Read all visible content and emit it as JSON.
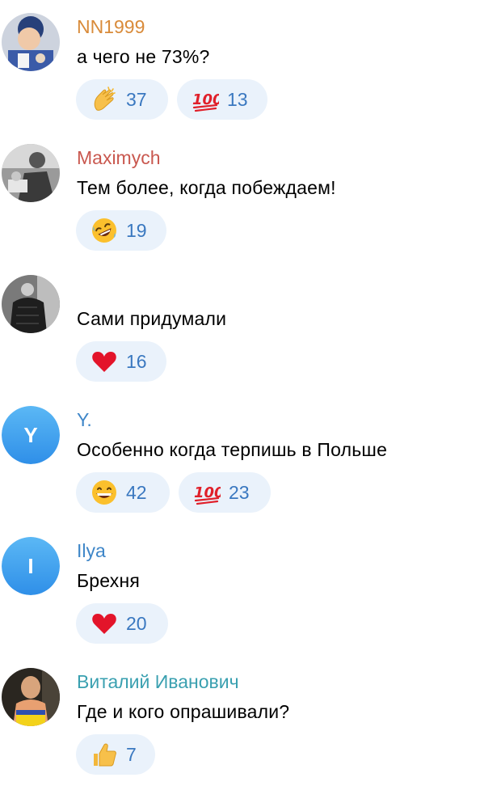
{
  "comments": [
    {
      "author": "NN1999",
      "author_color": "#d98b3a",
      "text": "а чего не 73%?",
      "avatar": "photo",
      "reactions": [
        {
          "emoji": "clapping-hands-icon",
          "count": "37"
        },
        {
          "emoji": "hundred-points-icon",
          "count": "13"
        }
      ]
    },
    {
      "author": "Maximych",
      "author_color": "#c9584f",
      "text": "Тем более, когда побеждаем!",
      "avatar": "photo",
      "reactions": [
        {
          "emoji": "rolling-laughing-face-icon",
          "count": "19"
        }
      ]
    },
    {
      "author": "",
      "text": "Сами придумали",
      "avatar": "photo",
      "reactions": [
        {
          "emoji": "red-heart-icon",
          "count": "16"
        }
      ]
    },
    {
      "author": "Y.",
      "author_color": "#3e86c8",
      "text": "Особенно когда терпишь в Польше",
      "avatar": "letter",
      "avatar_letter": "Y",
      "reactions": [
        {
          "emoji": "grinning-face-icon",
          "count": "42"
        },
        {
          "emoji": "hundred-points-icon",
          "count": "23"
        }
      ]
    },
    {
      "author": "Ilya",
      "author_color": "#3e86c8",
      "text": "Брехня",
      "avatar": "letter",
      "avatar_letter": "I",
      "reactions": [
        {
          "emoji": "red-heart-icon",
          "count": "20"
        }
      ]
    },
    {
      "author": "Виталий Иванович",
      "author_color": "#3aa0b0",
      "text": "Где и кого опрашивали?",
      "avatar": "photo",
      "reactions": [
        {
          "emoji": "thumbs-up-icon",
          "count": "7"
        }
      ]
    }
  ]
}
